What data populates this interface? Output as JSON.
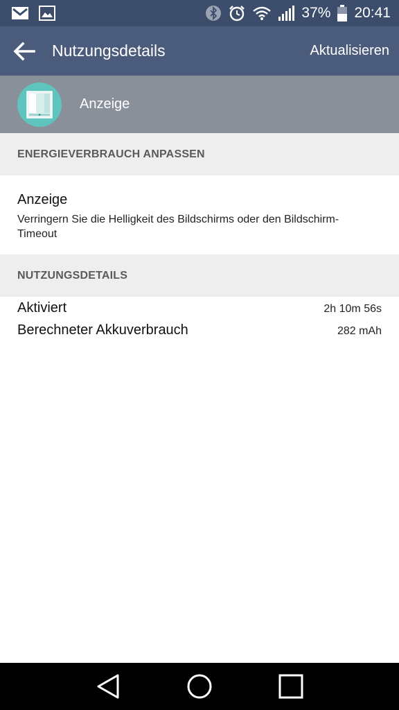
{
  "status_bar": {
    "battery_percent": "37%",
    "time": "20:41",
    "left_icons": [
      "gmail-icon",
      "image-icon"
    ],
    "right_icons": [
      "bluetooth-icon",
      "alarm-icon",
      "wifi-icon",
      "signal-icon",
      "battery-icon"
    ]
  },
  "app_bar": {
    "title": "Nutzungsdetails",
    "action_label": "Aktualisieren"
  },
  "app_header": {
    "name": "Anzeige",
    "icon_color": "#5fc3be"
  },
  "sections": {
    "adjust_header": "ENERGIEVERBRAUCH ANPASSEN",
    "usage_header": "NUTZUNGSDETAILS"
  },
  "adjust_option": {
    "title": "Anzeige",
    "description": "Verringern Sie die Helligkeit des Bildschirms oder den Bildschirm-Timeout"
  },
  "usage_details": [
    {
      "label": "Aktiviert",
      "value": "2h 10m 56s"
    },
    {
      "label": "Berechneter Akkuverbrauch",
      "value": "282 mAh"
    }
  ],
  "colors": {
    "status_bar": "#3c4d6b",
    "app_bar": "#4a5b7c",
    "app_header": "#8a909a",
    "section_header": "#eeeeee"
  }
}
